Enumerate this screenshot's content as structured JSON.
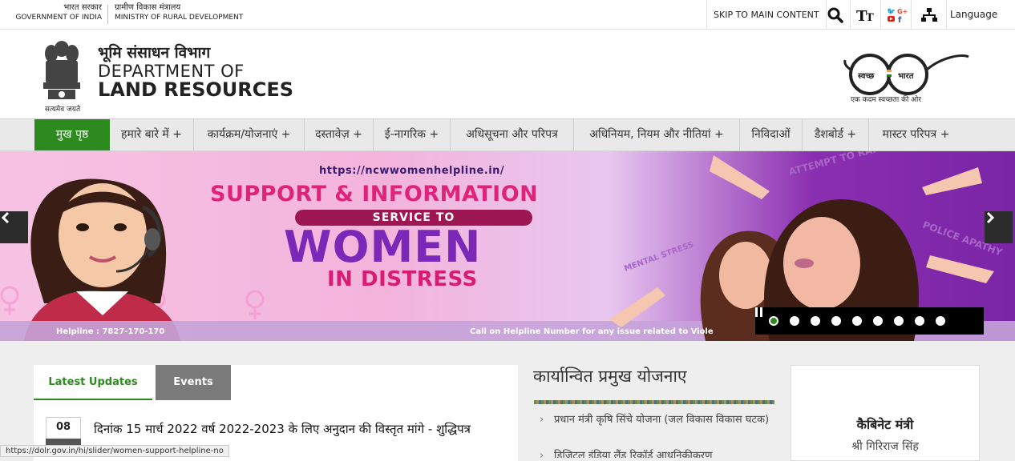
{
  "topbar": {
    "gov_hi": "भारत सरकार",
    "gov_en": "GOVERNMENT OF INDIA",
    "ministry_hi": "ग्रामीण विकास मंत्रालय",
    "ministry_en": "MINISTRY OF RURAL DEVELOPMENT",
    "skip": "SKIP TO MAIN CONTENT",
    "language": "Language"
  },
  "header": {
    "motto": "सत्यमेव जयते",
    "dept_hi": "भूमि संसाधन विभाग",
    "dept_en_line1": "DEPARTMENT OF",
    "dept_en_line2": "LAND RESOURCES",
    "swachh_left": "स्वच्छ",
    "swachh_right": "भारत",
    "swachh_tagline": "एक कदम स्वच्छता की ओर"
  },
  "nav": [
    {
      "label": "मुख पृष्ठ"
    },
    {
      "label": "हमारे बारे में +"
    },
    {
      "label": "कार्यक्रम/योजनाएं +"
    },
    {
      "label": "दस्तावेज़ +"
    },
    {
      "label": "ई-नागरिक +"
    },
    {
      "label": "अधिसूचना और परिपत्र"
    },
    {
      "label": "अधिनियम, नियम और नीतियां +"
    },
    {
      "label": "निविदाओं"
    },
    {
      "label": "डैशबोर्ड +"
    },
    {
      "label": "मास्टर परिपत्र +"
    }
  ],
  "banner": {
    "url": "https://ncwwomenhelpline.in/",
    "headline": "SUPPORT & INFORMATION",
    "service": "SERVICE TO",
    "women": "WOMEN",
    "distress": "IN DISTRESS",
    "helpline": "Helpline : 7827-170-170",
    "call_on": "Call on Helpline Number for any issue related to Viole",
    "labels": [
      "ATTEMPT TO RAPE",
      "POLICE APATHY",
      "MENTAL STRESS"
    ],
    "slides_total": 9,
    "active_slide": 1
  },
  "updates": {
    "tab_latest": "Latest Updates",
    "tab_events": "Events",
    "date_day": "08",
    "item_text": "दिनांक 15 मार्च 2022 वर्ष 2022-2023 के लिए अनुदान की विस्तृत मांगे - शुद्धिपत्र"
  },
  "schemes": {
    "title": "कार्यान्वित प्रमुख योजनाए",
    "items": [
      "प्रधान मंत्री कृषि सिंचे योजना (जल विकास विकास घटक)",
      "डिजिटल इंडिया लैंड रिकॉर्ड आधुनिकीकरण"
    ]
  },
  "cabinet": {
    "title": "कैबिनेट मंत्री",
    "name": "श्री गिरिराज सिंह"
  },
  "status_url": "https://dolr.gov.in/hi/slider/women-support-helpline-no",
  "colors": {
    "nav_active": "#2d8a1f",
    "banner_pink": "#f3b4dc",
    "banner_purple": "#7a24a6"
  }
}
